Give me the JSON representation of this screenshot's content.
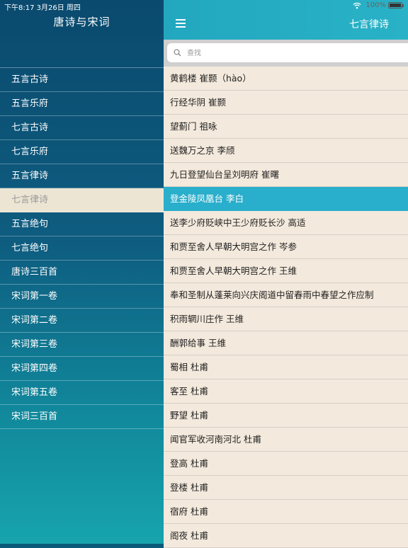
{
  "status_bar": {
    "time_date": "下午8:17  3月26日 周四",
    "battery_text": "100%"
  },
  "sidebar": {
    "title": "唐诗与宋词",
    "items": [
      {
        "label": "五言古诗"
      },
      {
        "label": "五言乐府"
      },
      {
        "label": "七言古诗"
      },
      {
        "label": "七言乐府"
      },
      {
        "label": "五言律诗"
      },
      {
        "label": "七言律诗",
        "active": true
      },
      {
        "label": "五言绝句"
      },
      {
        "label": "七言绝句"
      },
      {
        "label": "唐诗三百首"
      },
      {
        "label": "宋词第一卷"
      },
      {
        "label": "宋词第二卷"
      },
      {
        "label": "宋词第三卷"
      },
      {
        "label": "宋词第四卷"
      },
      {
        "label": "宋词第五卷"
      },
      {
        "label": "宋词三百首"
      }
    ]
  },
  "panel": {
    "title": "七言律诗",
    "search": {
      "placeholder": "查找",
      "value": ""
    },
    "poems": [
      {
        "label": "黄鹤楼 崔颢（hào）"
      },
      {
        "label": "行经华阴 崔颢"
      },
      {
        "label": "望蓟门 祖咏"
      },
      {
        "label": "送魏万之京 李颀"
      },
      {
        "label": "九日登望仙台呈刘明府 崔曙"
      },
      {
        "label": "登金陵凤凰台 李白",
        "selected": true
      },
      {
        "label": "送李少府贬峡中王少府贬长沙 高适"
      },
      {
        "label": "和贾至舍人早朝大明宫之作 岑参"
      },
      {
        "label": "和贾至舍人早朝大明宫之作 王维"
      },
      {
        "label": "奉和圣制从蓬莱向兴庆阁道中留春雨中春望之作应制"
      },
      {
        "label": "积雨辋川庄作 王维"
      },
      {
        "label": "酬郭给事 王维"
      },
      {
        "label": "蜀相 杜甫"
      },
      {
        "label": "客至 杜甫"
      },
      {
        "label": "野望 杜甫"
      },
      {
        "label": "闻官军收河南河北 杜甫"
      },
      {
        "label": "登高 杜甫"
      },
      {
        "label": "登楼 杜甫"
      },
      {
        "label": "宿府 杜甫"
      },
      {
        "label": "阁夜 杜甫"
      }
    ]
  },
  "colors": {
    "navbar": "#29b2c7",
    "selected_row": "#29aecb",
    "list_background": "#f3e9dc",
    "sidebar_active": "#ece5d4"
  }
}
